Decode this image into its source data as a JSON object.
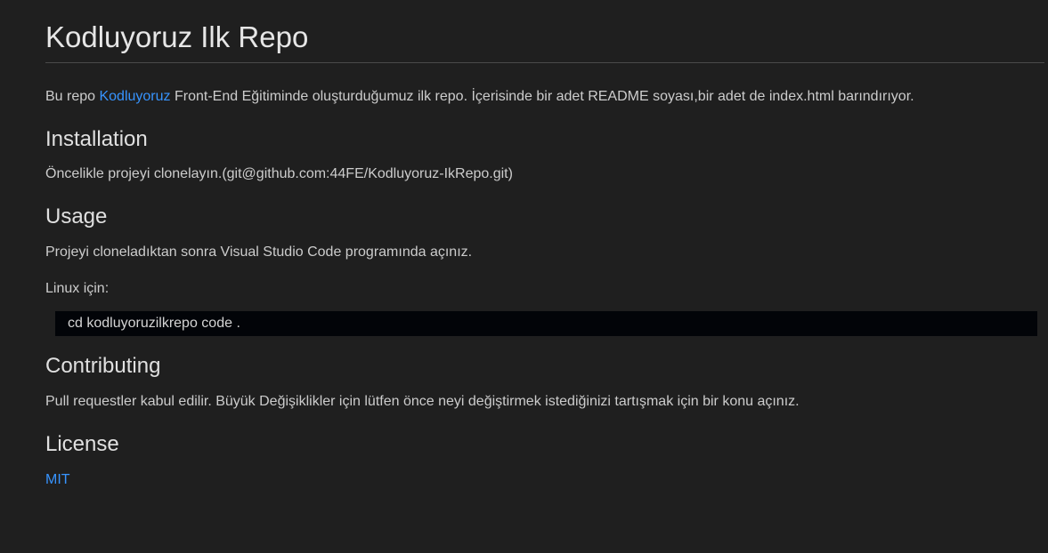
{
  "title": "Kodluyoruz Ilk Repo",
  "intro": {
    "before": "Bu repo ",
    "link": "Kodluyoruz",
    "after": " Front-End Eğitiminde oluşturduğumuz ilk repo. İçerisinde bir adet README soyası,bir adet de index.html barındırıyor."
  },
  "installation": {
    "heading": "Installation",
    "text": "Öncelikle projeyi clonelayın.(git@github.com:44FE/Kodluyoruz-IkRepo.git)"
  },
  "usage": {
    "heading": "Usage",
    "text": "Projeyi cloneladıktan sonra Visual Studio Code programında açınız.",
    "linux_label": "Linux için:",
    "code": "cd kodluyoruzilkrepo code ."
  },
  "contributing": {
    "heading": "Contributing",
    "text": "Pull requestler kabul edilir. Büyük Değişiklikler için lütfen önce neyi değiştirmek istediğinizi tartışmak için bir konu açınız."
  },
  "license": {
    "heading": "License",
    "link": "MIT"
  },
  "colors": {
    "background": "#1f1f1f",
    "link": "#3794ff",
    "code_background": "#020408"
  }
}
